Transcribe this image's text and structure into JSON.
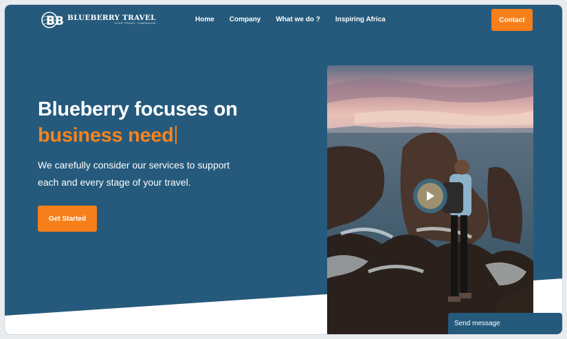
{
  "brand": {
    "monogram": "BB",
    "name": "BLUEBERRY TRAVEL",
    "tagline": "YOUR TRAVEL COMPANION"
  },
  "nav": {
    "items": [
      {
        "label": "Home"
      },
      {
        "label": "Company"
      },
      {
        "label": "What we do ?"
      },
      {
        "label": "Inspiring Africa"
      }
    ],
    "contact_label": "Contact"
  },
  "hero": {
    "headline_line1": "Blueberry focuses on",
    "headline_line2": "business need",
    "description": "We carefully consider our services to support each and every stage of your travel.",
    "cta_label": "Get Started"
  },
  "media": {
    "image_subject": "traveler-on-sea-cliff-photo",
    "play_icon": "play-icon"
  },
  "chat": {
    "label": "Send message"
  },
  "colors": {
    "hero_background": "#255a7c",
    "accent_orange": "#f77f1a",
    "page_bottom": "#ffffff"
  }
}
